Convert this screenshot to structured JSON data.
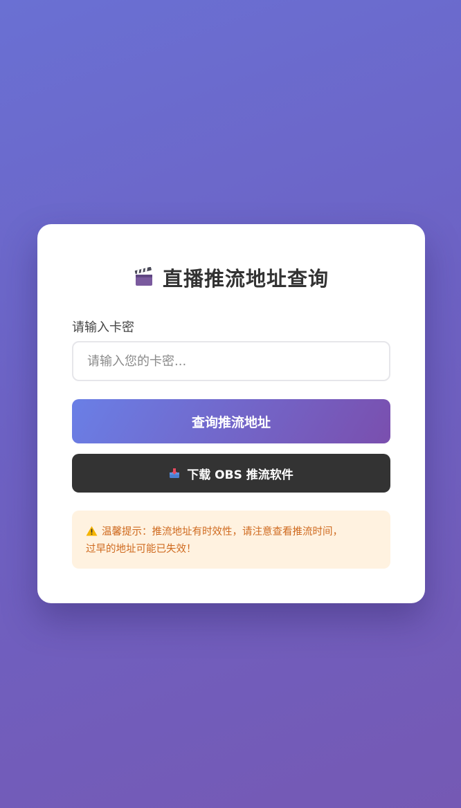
{
  "title": {
    "icon": "clapperboard-icon",
    "text": "直播推流地址查询"
  },
  "form": {
    "label": "请输入卡密",
    "input_value": "",
    "input_placeholder": "请输入您的卡密..."
  },
  "buttons": {
    "query_label": "查询推流地址",
    "download_icon": "inbox-tray-icon",
    "download_label": "下载 OBS 推流软件"
  },
  "notice": {
    "icon": "warning-icon",
    "line1": "温馨提示：推流地址有时效性，请注意查看推流时间，",
    "line2": "过早的地址可能已失效！"
  },
  "colors": {
    "background_start": "#6a70d3",
    "background_end": "#7559b4",
    "query_button_start": "#6a7fe6",
    "query_button_end": "#7a4fae",
    "download_button": "#333333",
    "notice_background": "#fff2e0",
    "notice_text": "#cf6a1f"
  }
}
